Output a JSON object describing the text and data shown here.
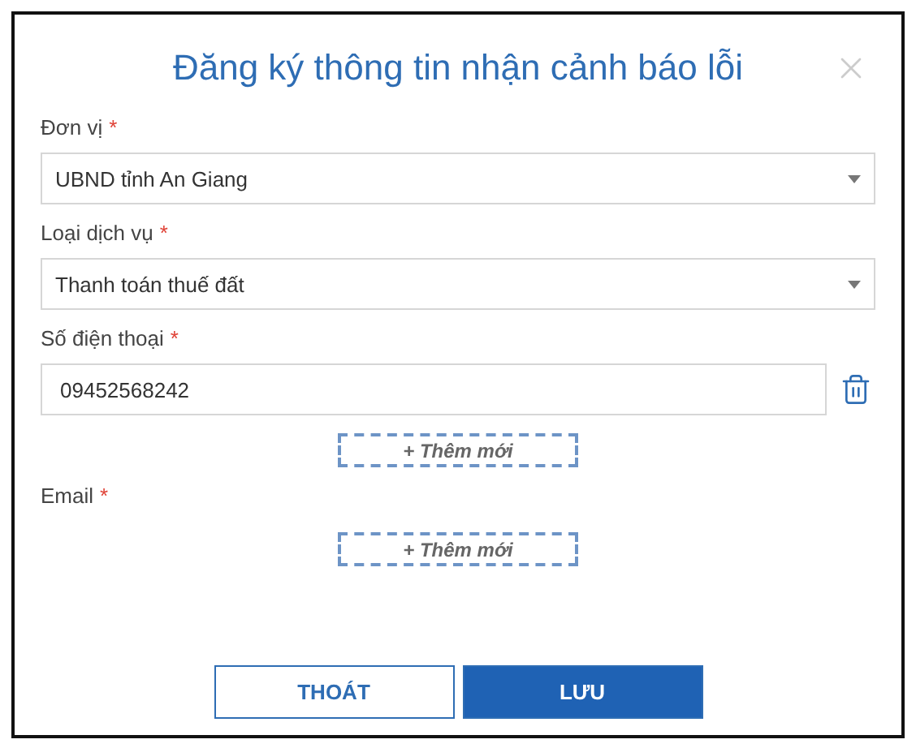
{
  "dialog": {
    "title": "Đăng ký thông tin nhận cảnh báo lỗi"
  },
  "fields": [
    {
      "kind": "select",
      "label": "Đơn vị",
      "required_mark": "*",
      "value": "UBND tỉnh An Giang"
    },
    {
      "kind": "select",
      "label": "Loại dịch vụ",
      "required_mark": "*",
      "value": "Thanh toán thuế đất"
    },
    {
      "kind": "list",
      "label": "Số điện thoại",
      "required_mark": "*",
      "values": [
        "09452568242"
      ],
      "add_label": "+ Thêm mới"
    },
    {
      "kind": "list",
      "label": "Email",
      "required_mark": "*",
      "add_label": "+ Thêm mới"
    }
  ],
  "buttons": [
    {
      "label": "THOÁT",
      "kind": "secondary"
    },
    {
      "label": "LƯU",
      "kind": "primary"
    }
  ]
}
